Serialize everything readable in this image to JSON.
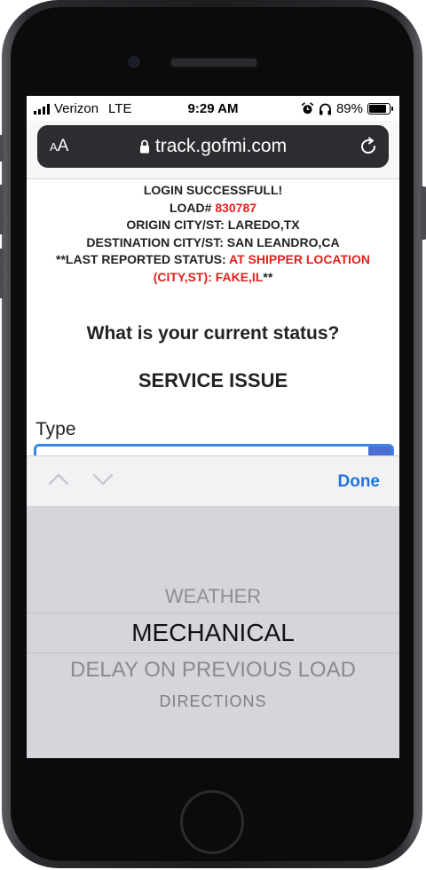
{
  "status_bar": {
    "carrier": "Verizon",
    "network": "LTE",
    "time": "9:29 AM",
    "battery": "89%"
  },
  "browser": {
    "text_size_label": "AA",
    "url": "track.gofmi.com"
  },
  "load_info": {
    "login_message": "LOGIN SUCCESSFULL!",
    "load_label": "LOAD#",
    "load_number": "830787",
    "origin": "ORIGIN CITY/ST: LAREDO,TX",
    "destination": "DESTINATION CITY/ST: SAN LEANDRO,CA",
    "last_status_label": "**LAST REPORTED STATUS:",
    "last_status_value_1": "AT SHIPPER LOCATION",
    "last_status_value_2": "(CITY,ST): FAKE,IL",
    "last_status_suffix": "**"
  },
  "form": {
    "question": "What is your current status?",
    "issue_heading": "SERVICE ISSUE",
    "type_label": "Type"
  },
  "keyboard_toolbar": {
    "done_label": "Done"
  },
  "picker": {
    "options": [
      "WEATHER",
      "MECHANICAL",
      "DELAY ON PREVIOUS LOAD",
      "DIRECTIONS"
    ],
    "selected": "MECHANICAL"
  },
  "colors": {
    "accent_red": "#e3201b",
    "link_blue": "#1d74db",
    "select_border": "#3b86e6"
  },
  "icons": [
    "signal-icon",
    "alarm-icon",
    "headphones-icon",
    "battery-icon",
    "lock-icon",
    "reload-icon",
    "chevron-up-icon",
    "chevron-down-icon"
  ]
}
